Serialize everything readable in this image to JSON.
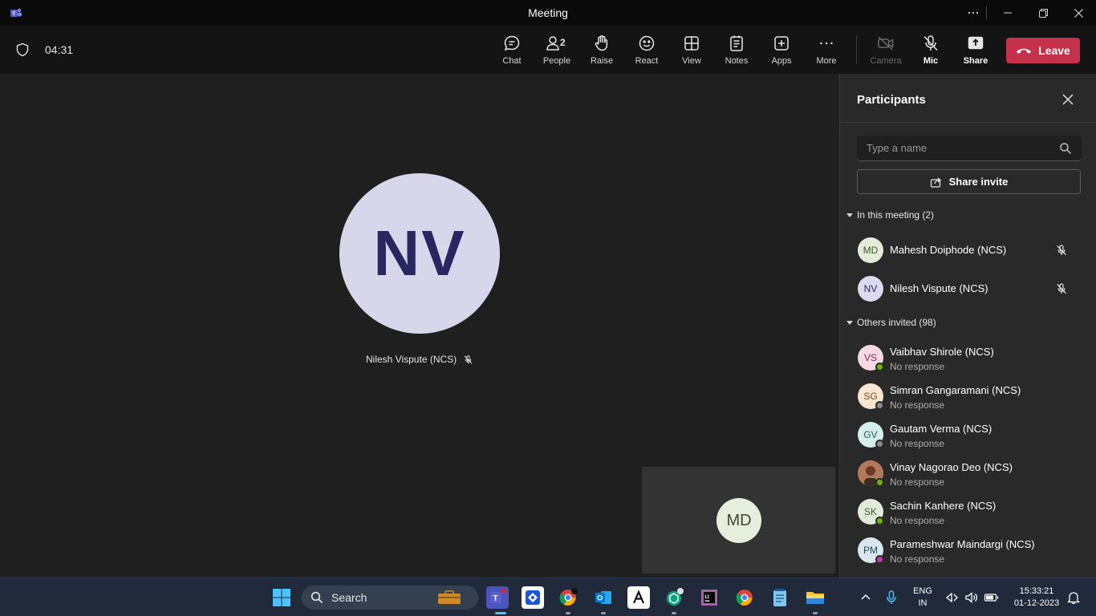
{
  "window": {
    "title": "Meeting"
  },
  "toolbar": {
    "timer": "04:31",
    "people_count": "2",
    "buttons": {
      "chat": "Chat",
      "people": "People",
      "raise": "Raise",
      "react": "React",
      "view": "View",
      "notes": "Notes",
      "apps": "Apps",
      "more": "More",
      "camera": "Camera",
      "mic": "Mic",
      "share": "Share"
    },
    "leave": "Leave",
    "leave_color": "#c4314b",
    "active_tab_color": "#7f85f5"
  },
  "stage": {
    "main_initials": "NV",
    "main_name": "Nilesh Vispute (NCS)",
    "self_initials": "MD"
  },
  "panel": {
    "title": "Participants",
    "search_placeholder": "Type a name",
    "share_invite": "Share invite",
    "in_meeting_header": "In this meeting (2)",
    "in_meeting": [
      {
        "initials": "MD",
        "name": "Mahesh Doiphode (NCS)",
        "avatar_bg": "#e4ecd9",
        "avatar_fg": "#3f5a2a"
      },
      {
        "initials": "NV",
        "name": "Nilesh Vispute (NCS)",
        "avatar_bg": "#dcdaf0",
        "avatar_fg": "#2a2660"
      }
    ],
    "others_header": "Others invited (98)",
    "others": [
      {
        "initials": "VS",
        "name": "Vaibhav Shirole (NCS)",
        "status": "No response",
        "avatar_bg": "#f6d9e2",
        "avatar_fg": "#8a2a4a",
        "presence": "available"
      },
      {
        "initials": "SG",
        "name": "Simran Gangaramani (NCS)",
        "status": "No response",
        "avatar_bg": "#f8e6d2",
        "avatar_fg": "#8a4a1a",
        "presence": "offline"
      },
      {
        "initials": "GV",
        "name": "Gautam Verma (NCS)",
        "status": "No response",
        "avatar_bg": "#d6eeec",
        "avatar_fg": "#1f5a55",
        "presence": "offline"
      },
      {
        "initials": "",
        "name": "Vinay Nagorao Deo (NCS)",
        "status": "No response",
        "avatar_bg": "#7a4a35",
        "avatar_fg": "#ffffff",
        "presence": "available"
      },
      {
        "initials": "SK",
        "name": "Sachin Kanhere (NCS)",
        "status": "No response",
        "avatar_bg": "#e2ead9",
        "avatar_fg": "#3f5a2a",
        "presence": "available"
      },
      {
        "initials": "PM",
        "name": "Parameshwar Maindargi (NCS)",
        "status": "No response",
        "avatar_bg": "#d9e6ee",
        "avatar_fg": "#1f4a5a",
        "presence": "dnd"
      }
    ]
  },
  "taskbar": {
    "search_label": "Search",
    "lang_line1": "ENG",
    "lang_line2": "IN",
    "time": "15:33:21",
    "date": "01-12-2023"
  }
}
